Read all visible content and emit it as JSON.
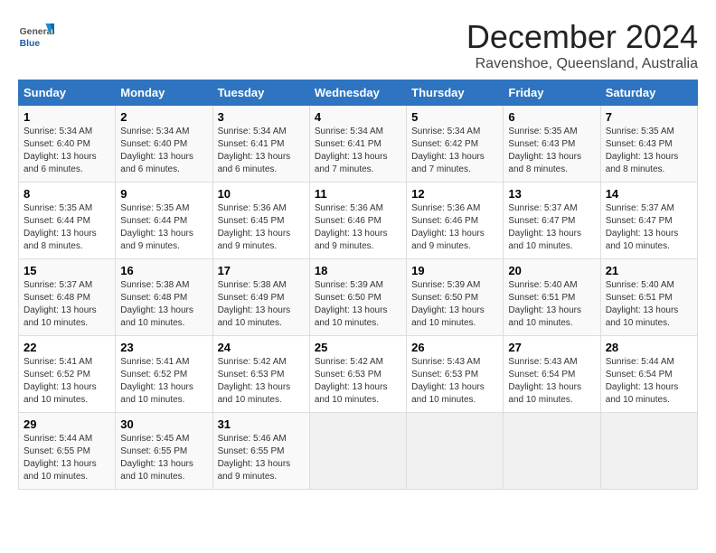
{
  "logo": {
    "general": "General",
    "blue": "Blue"
  },
  "title": "December 2024",
  "subtitle": "Ravenshoe, Queensland, Australia",
  "headers": [
    "Sunday",
    "Monday",
    "Tuesday",
    "Wednesday",
    "Thursday",
    "Friday",
    "Saturday"
  ],
  "weeks": [
    [
      {
        "day": "1",
        "info": "Sunrise: 5:34 AM\nSunset: 6:40 PM\nDaylight: 13 hours\nand 6 minutes."
      },
      {
        "day": "2",
        "info": "Sunrise: 5:34 AM\nSunset: 6:40 PM\nDaylight: 13 hours\nand 6 minutes."
      },
      {
        "day": "3",
        "info": "Sunrise: 5:34 AM\nSunset: 6:41 PM\nDaylight: 13 hours\nand 6 minutes."
      },
      {
        "day": "4",
        "info": "Sunrise: 5:34 AM\nSunset: 6:41 PM\nDaylight: 13 hours\nand 7 minutes."
      },
      {
        "day": "5",
        "info": "Sunrise: 5:34 AM\nSunset: 6:42 PM\nDaylight: 13 hours\nand 7 minutes."
      },
      {
        "day": "6",
        "info": "Sunrise: 5:35 AM\nSunset: 6:43 PM\nDaylight: 13 hours\nand 8 minutes."
      },
      {
        "day": "7",
        "info": "Sunrise: 5:35 AM\nSunset: 6:43 PM\nDaylight: 13 hours\nand 8 minutes."
      }
    ],
    [
      {
        "day": "8",
        "info": "Sunrise: 5:35 AM\nSunset: 6:44 PM\nDaylight: 13 hours\nand 8 minutes."
      },
      {
        "day": "9",
        "info": "Sunrise: 5:35 AM\nSunset: 6:44 PM\nDaylight: 13 hours\nand 9 minutes."
      },
      {
        "day": "10",
        "info": "Sunrise: 5:36 AM\nSunset: 6:45 PM\nDaylight: 13 hours\nand 9 minutes."
      },
      {
        "day": "11",
        "info": "Sunrise: 5:36 AM\nSunset: 6:46 PM\nDaylight: 13 hours\nand 9 minutes."
      },
      {
        "day": "12",
        "info": "Sunrise: 5:36 AM\nSunset: 6:46 PM\nDaylight: 13 hours\nand 9 minutes."
      },
      {
        "day": "13",
        "info": "Sunrise: 5:37 AM\nSunset: 6:47 PM\nDaylight: 13 hours\nand 10 minutes."
      },
      {
        "day": "14",
        "info": "Sunrise: 5:37 AM\nSunset: 6:47 PM\nDaylight: 13 hours\nand 10 minutes."
      }
    ],
    [
      {
        "day": "15",
        "info": "Sunrise: 5:37 AM\nSunset: 6:48 PM\nDaylight: 13 hours\nand 10 minutes."
      },
      {
        "day": "16",
        "info": "Sunrise: 5:38 AM\nSunset: 6:48 PM\nDaylight: 13 hours\nand 10 minutes."
      },
      {
        "day": "17",
        "info": "Sunrise: 5:38 AM\nSunset: 6:49 PM\nDaylight: 13 hours\nand 10 minutes."
      },
      {
        "day": "18",
        "info": "Sunrise: 5:39 AM\nSunset: 6:50 PM\nDaylight: 13 hours\nand 10 minutes."
      },
      {
        "day": "19",
        "info": "Sunrise: 5:39 AM\nSunset: 6:50 PM\nDaylight: 13 hours\nand 10 minutes."
      },
      {
        "day": "20",
        "info": "Sunrise: 5:40 AM\nSunset: 6:51 PM\nDaylight: 13 hours\nand 10 minutes."
      },
      {
        "day": "21",
        "info": "Sunrise: 5:40 AM\nSunset: 6:51 PM\nDaylight: 13 hours\nand 10 minutes."
      }
    ],
    [
      {
        "day": "22",
        "info": "Sunrise: 5:41 AM\nSunset: 6:52 PM\nDaylight: 13 hours\nand 10 minutes."
      },
      {
        "day": "23",
        "info": "Sunrise: 5:41 AM\nSunset: 6:52 PM\nDaylight: 13 hours\nand 10 minutes."
      },
      {
        "day": "24",
        "info": "Sunrise: 5:42 AM\nSunset: 6:53 PM\nDaylight: 13 hours\nand 10 minutes."
      },
      {
        "day": "25",
        "info": "Sunrise: 5:42 AM\nSunset: 6:53 PM\nDaylight: 13 hours\nand 10 minutes."
      },
      {
        "day": "26",
        "info": "Sunrise: 5:43 AM\nSunset: 6:53 PM\nDaylight: 13 hours\nand 10 minutes."
      },
      {
        "day": "27",
        "info": "Sunrise: 5:43 AM\nSunset: 6:54 PM\nDaylight: 13 hours\nand 10 minutes."
      },
      {
        "day": "28",
        "info": "Sunrise: 5:44 AM\nSunset: 6:54 PM\nDaylight: 13 hours\nand 10 minutes."
      }
    ],
    [
      {
        "day": "29",
        "info": "Sunrise: 5:44 AM\nSunset: 6:55 PM\nDaylight: 13 hours\nand 10 minutes."
      },
      {
        "day": "30",
        "info": "Sunrise: 5:45 AM\nSunset: 6:55 PM\nDaylight: 13 hours\nand 10 minutes."
      },
      {
        "day": "31",
        "info": "Sunrise: 5:46 AM\nSunset: 6:55 PM\nDaylight: 13 hours\nand 9 minutes."
      },
      {
        "day": "",
        "info": ""
      },
      {
        "day": "",
        "info": ""
      },
      {
        "day": "",
        "info": ""
      },
      {
        "day": "",
        "info": ""
      }
    ]
  ]
}
